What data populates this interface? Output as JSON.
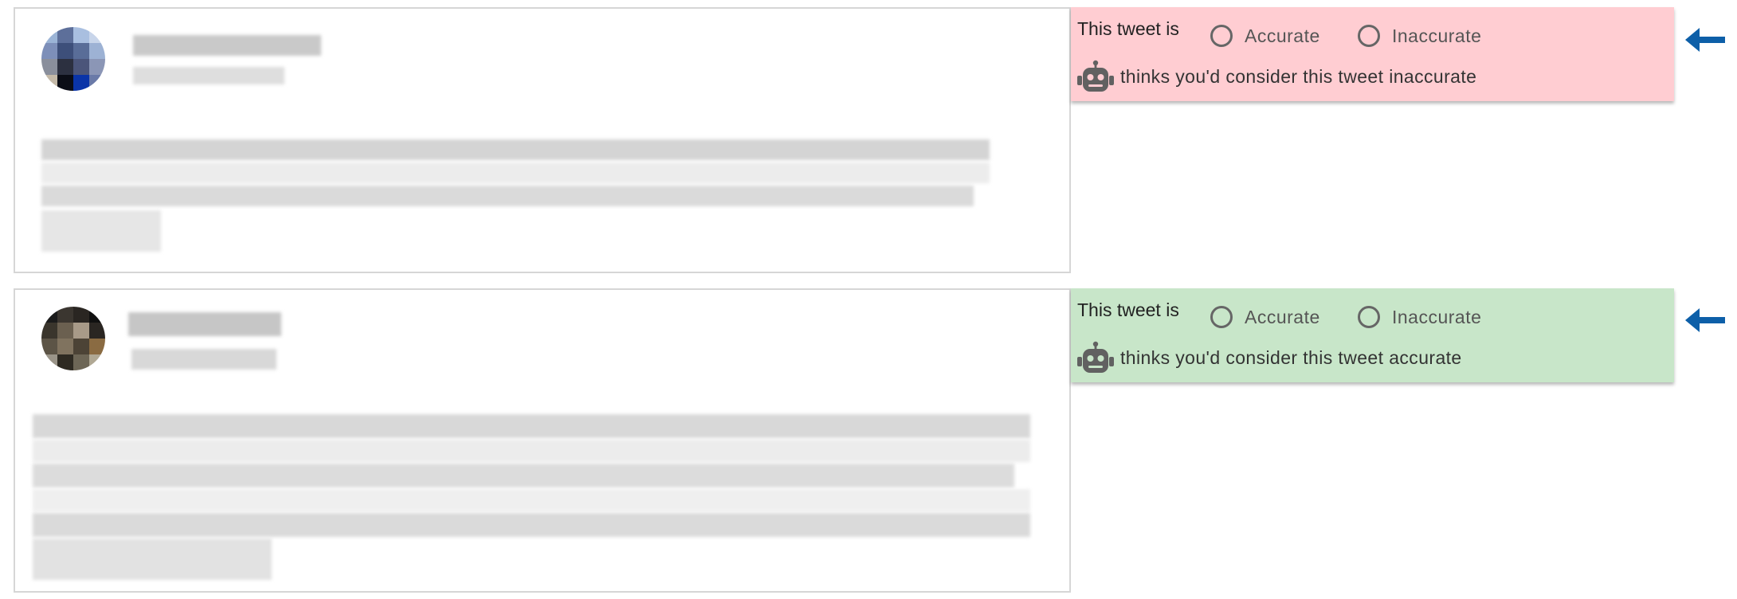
{
  "colors": {
    "panel_inaccurate_bg": "#ffcdd2",
    "panel_accurate_bg": "#c8e6c9",
    "arrow": "#0d5fa8"
  },
  "annotations": [
    {
      "prompt": "This tweet is",
      "option_accurate": "Accurate",
      "option_inaccurate": "Inaccurate",
      "bot_icon": "robot-icon",
      "ai_message": "thinks you'd consider this tweet inaccurate"
    },
    {
      "prompt": "This tweet is",
      "option_accurate": "Accurate",
      "option_inaccurate": "Inaccurate",
      "bot_icon": "robot-icon",
      "ai_message": "thinks you'd consider this tweet accurate"
    }
  ],
  "arrow_icon": "arrow-left-icon"
}
